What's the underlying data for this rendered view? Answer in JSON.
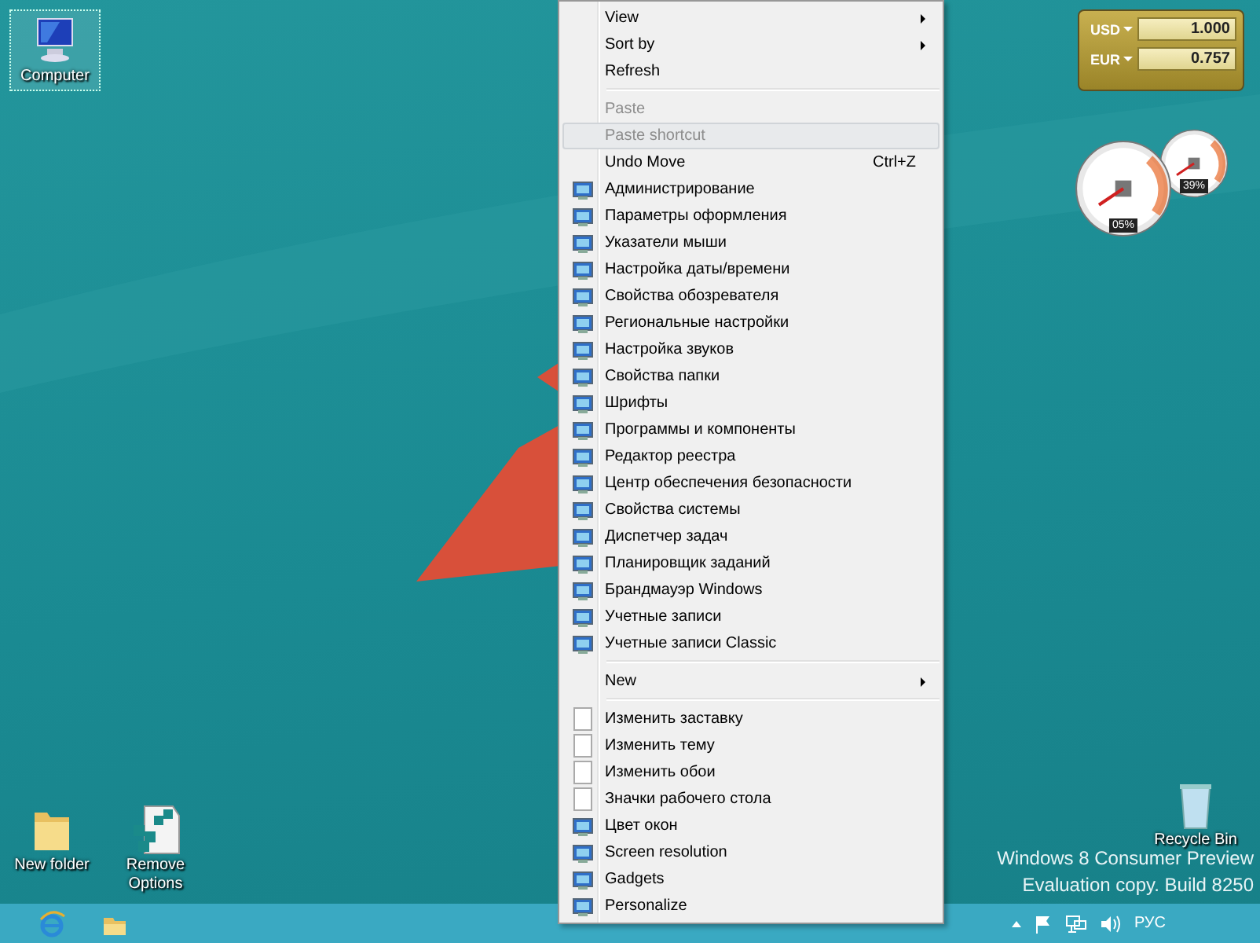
{
  "desktop_icons": [
    {
      "label": "Computer",
      "kind": "computer",
      "selected": true
    },
    {
      "label": "New folder",
      "kind": "folder",
      "selected": false
    },
    {
      "label": "Remove Options",
      "kind": "registry",
      "selected": false
    },
    {
      "label": "Recycle Bin",
      "kind": "bin",
      "selected": false
    }
  ],
  "context_menu": {
    "items": [
      {
        "kind": "plain",
        "label": "View",
        "has_submenu": true,
        "disabled": false,
        "selected": false
      },
      {
        "kind": "plain",
        "label": "Sort by",
        "has_submenu": true,
        "disabled": false,
        "selected": false
      },
      {
        "kind": "plain",
        "label": "Refresh",
        "has_submenu": false,
        "disabled": false,
        "selected": false
      },
      {
        "kind": "separator"
      },
      {
        "kind": "plain",
        "label": "Paste",
        "has_submenu": false,
        "disabled": true,
        "selected": false
      },
      {
        "kind": "plain",
        "label": "Paste shortcut",
        "has_submenu": false,
        "disabled": true,
        "selected": true
      },
      {
        "kind": "plain",
        "label": "Undo Move",
        "shortcut": "Ctrl+Z",
        "has_submenu": false,
        "disabled": false,
        "selected": false
      },
      {
        "kind": "icon",
        "label": "Администрирование",
        "has_submenu": false,
        "disabled": false,
        "selected": false
      },
      {
        "kind": "icon",
        "label": "Параметры оформления",
        "has_submenu": false,
        "disabled": false,
        "selected": false
      },
      {
        "kind": "icon",
        "label": "Указатели мыши",
        "has_submenu": false,
        "disabled": false,
        "selected": false
      },
      {
        "kind": "icon",
        "label": "Настройка даты/времени",
        "has_submenu": false,
        "disabled": false,
        "selected": false
      },
      {
        "kind": "icon",
        "label": "Свойства обозревателя",
        "has_submenu": false,
        "disabled": false,
        "selected": false
      },
      {
        "kind": "icon",
        "label": "Региональные настройки",
        "has_submenu": false,
        "disabled": false,
        "selected": false
      },
      {
        "kind": "icon",
        "label": "Настройка звуков",
        "has_submenu": false,
        "disabled": false,
        "selected": false
      },
      {
        "kind": "icon",
        "label": "Свойства папки",
        "has_submenu": false,
        "disabled": false,
        "selected": false
      },
      {
        "kind": "icon",
        "label": "Шрифты",
        "has_submenu": false,
        "disabled": false,
        "selected": false
      },
      {
        "kind": "icon",
        "label": "Программы и компоненты",
        "has_submenu": false,
        "disabled": false,
        "selected": false
      },
      {
        "kind": "icon",
        "label": "Редактор реестра",
        "has_submenu": false,
        "disabled": false,
        "selected": false
      },
      {
        "kind": "icon",
        "label": "Центр обеспечения безопасности",
        "has_submenu": false,
        "disabled": false,
        "selected": false
      },
      {
        "kind": "icon",
        "label": "Свойства системы",
        "has_submenu": false,
        "disabled": false,
        "selected": false
      },
      {
        "kind": "icon",
        "label": "Диспетчер задач",
        "has_submenu": false,
        "disabled": false,
        "selected": false
      },
      {
        "kind": "icon",
        "label": "Планировщик заданий",
        "has_submenu": false,
        "disabled": false,
        "selected": false
      },
      {
        "kind": "icon",
        "label": "Брандмауэр Windows",
        "has_submenu": false,
        "disabled": false,
        "selected": false
      },
      {
        "kind": "icon",
        "label": "Учетные записи",
        "has_submenu": false,
        "disabled": false,
        "selected": false
      },
      {
        "kind": "icon",
        "label": "Учетные записи Classic",
        "has_submenu": false,
        "disabled": false,
        "selected": false
      },
      {
        "kind": "separator"
      },
      {
        "kind": "plain",
        "label": "New",
        "has_submenu": true,
        "disabled": false,
        "selected": false
      },
      {
        "kind": "separator"
      },
      {
        "kind": "page",
        "label": "Изменить заставку",
        "has_submenu": false,
        "disabled": false,
        "selected": false
      },
      {
        "kind": "page",
        "label": "Изменить тему",
        "has_submenu": false,
        "disabled": false,
        "selected": false
      },
      {
        "kind": "page",
        "label": "Изменить обои",
        "has_submenu": false,
        "disabled": false,
        "selected": false
      },
      {
        "kind": "page",
        "label": "Значки рабочего стола",
        "has_submenu": false,
        "disabled": false,
        "selected": false
      },
      {
        "kind": "icon",
        "label": "Цвет окон",
        "has_submenu": false,
        "disabled": false,
        "selected": false
      },
      {
        "kind": "icon",
        "label": "Screen resolution",
        "has_submenu": false,
        "disabled": false,
        "selected": false
      },
      {
        "kind": "icon",
        "label": "Gadgets",
        "has_submenu": false,
        "disabled": false,
        "selected": false
      },
      {
        "kind": "icon",
        "label": "Personalize",
        "has_submenu": false,
        "disabled": false,
        "selected": false
      }
    ]
  },
  "currency_gadget": {
    "rows": [
      {
        "currency": "USD",
        "value": "1.000"
      },
      {
        "currency": "EUR",
        "value": "0.757"
      }
    ]
  },
  "meter_gadget": {
    "gauges": [
      {
        "reading": "05%"
      },
      {
        "reading": "39%"
      }
    ]
  },
  "os_watermark": {
    "line_1": "Windows 8 Consumer Preview",
    "line_2": "Evaluation copy. Build 8250"
  },
  "taskbar": {
    "pinned": [
      {
        "kind": "browser"
      },
      {
        "kind": "explorer"
      }
    ],
    "language": "РУС"
  }
}
